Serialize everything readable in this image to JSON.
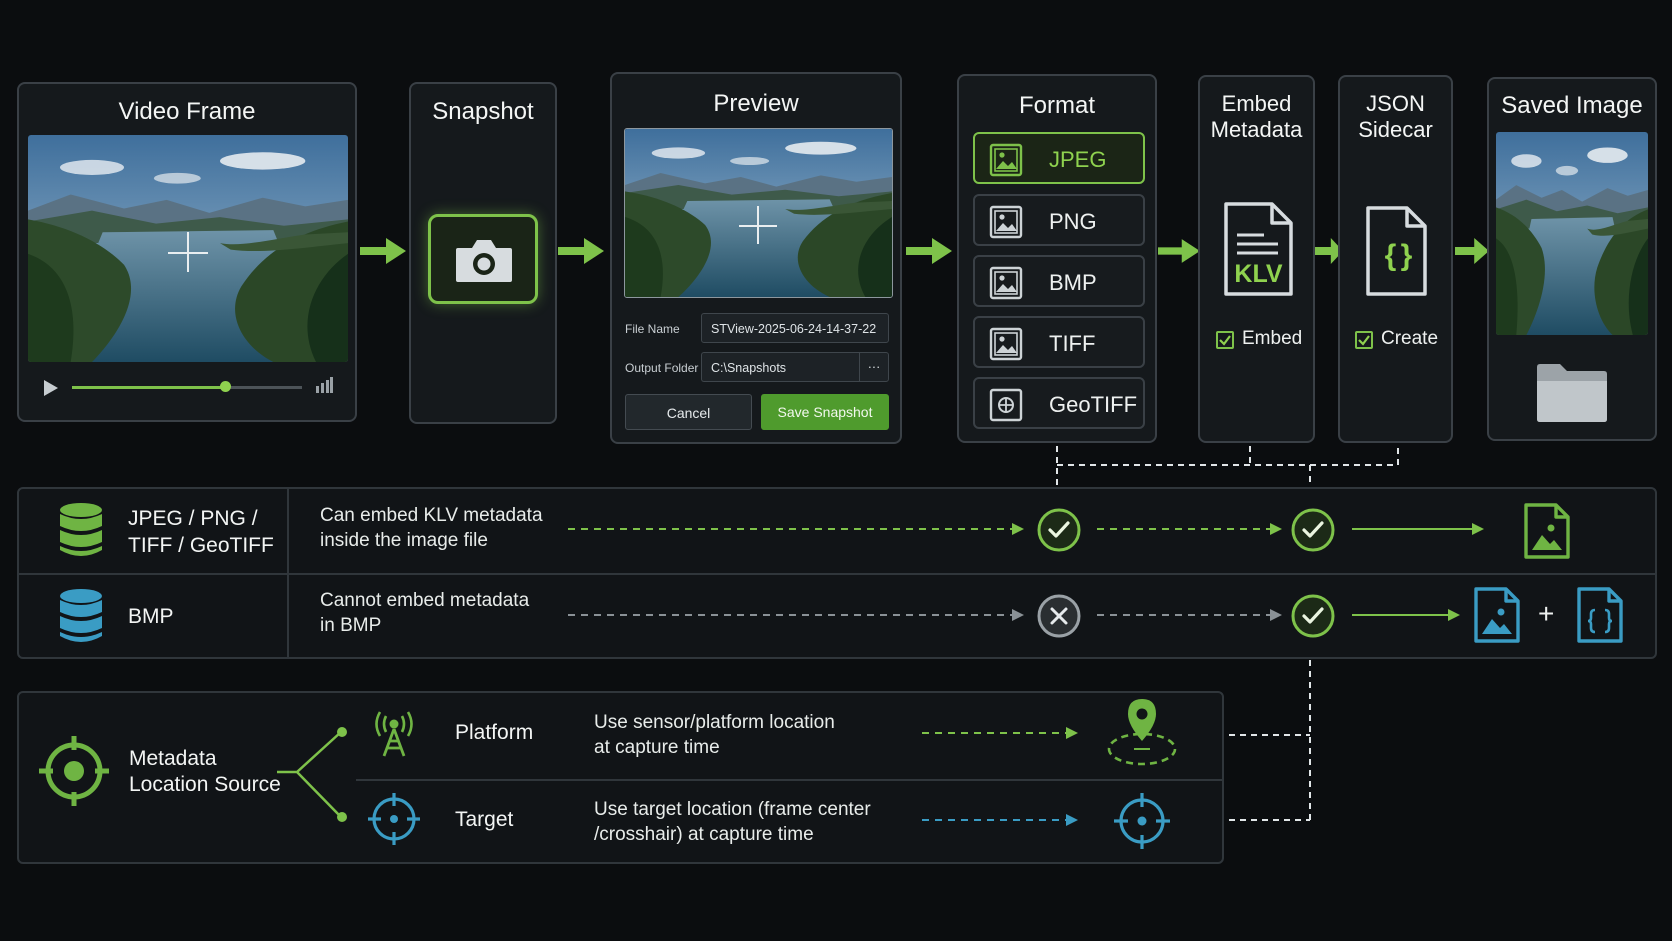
{
  "cards": {
    "video_frame": {
      "title": "Video Frame"
    },
    "snapshot": {
      "title": "Snapshot"
    },
    "preview": {
      "title": "Preview",
      "file_name_label": "File Name",
      "file_name_value": "STView-2025-06-24-14-37-22",
      "output_folder_label": "Output Folder",
      "output_folder_value": "C:\\Snapshots",
      "browse_label": "···",
      "cancel_label": "Cancel",
      "save_label": "Save Snapshot"
    },
    "format": {
      "title": "Format",
      "options": [
        "JPEG",
        "PNG",
        "BMP",
        "TIFF",
        "GeoTIFF"
      ],
      "selected": "JPEG"
    },
    "embed_metadata": {
      "title_line1": "Embed",
      "title_line2": "Metadata",
      "doc_label": "KLV",
      "checkbox_label": "Embed",
      "checked": true
    },
    "json_sidecar": {
      "title_line1": "JSON",
      "title_line2": "Sidecar",
      "doc_label": "{ }",
      "checkbox_label": "Create",
      "checked": true
    },
    "saved_image": {
      "title": "Saved Image"
    }
  },
  "format_rows": [
    {
      "formats_line1": "JPEG / PNG /",
      "formats_line2": "TIFF / GeoTIFF",
      "desc_line1": "Can embed KLV metadata",
      "desc_line2": "inside the image file",
      "embed": "yes",
      "sidecar": "yes"
    },
    {
      "formats_line1": "BMP",
      "formats_line2": "",
      "desc_line1": "Cannot embed metadata",
      "desc_line2": "in BMP",
      "embed": "no",
      "sidecar": "yes",
      "plus": "+"
    }
  ],
  "location_source": {
    "title_line1": "Metadata",
    "title_line2": "Location Source",
    "options": [
      {
        "name": "Platform",
        "desc_line1": "Use sensor/platform location",
        "desc_line2": "at capture time"
      },
      {
        "name": "Target",
        "desc_line1": "Use target location (frame center",
        "desc_line2": "/crosshair) at capture time"
      }
    ]
  },
  "colors": {
    "accent_green": "#7ec24a",
    "accent_blue": "#3a9cc4",
    "card_border": "#3a4046",
    "background": "#0b0d0f",
    "reject_gray": "#9aa1a6"
  }
}
